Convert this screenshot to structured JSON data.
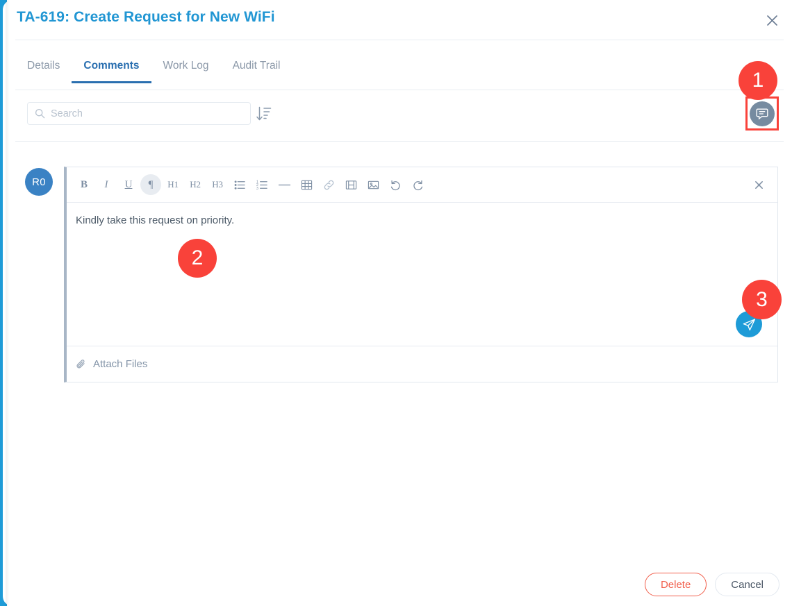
{
  "modal": {
    "title": "TA-619: Create Request for New WiFi",
    "close_icon": "close-icon"
  },
  "tabs": [
    {
      "label": "Details",
      "active": false
    },
    {
      "label": "Comments",
      "active": true
    },
    {
      "label": "Work Log",
      "active": false
    },
    {
      "label": "Audit Trail",
      "active": false
    }
  ],
  "search": {
    "placeholder": "Search",
    "value": "",
    "icon": "search-icon",
    "sort_icon": "sort-descending-icon"
  },
  "comment_toggle": {
    "icon": "comment-bubble-icon"
  },
  "editor": {
    "avatar_initials": "R0",
    "close_icon": "close-icon",
    "text": "Kindly take this request on priority.",
    "send_icon": "send-paper-plane-icon",
    "attach_label": "Attach Files",
    "attach_icon": "paperclip-icon",
    "toolbar": [
      {
        "name": "bold-button",
        "label": "B",
        "kind": "bold",
        "active": false
      },
      {
        "name": "italic-button",
        "label": "I",
        "kind": "italic",
        "active": false
      },
      {
        "name": "underline-button",
        "label": "U",
        "kind": "under",
        "active": false
      },
      {
        "name": "paragraph-button",
        "label": "¶",
        "kind": "para",
        "active": true
      },
      {
        "name": "heading-1-button",
        "label": "H1",
        "kind": "heading",
        "active": false
      },
      {
        "name": "heading-2-button",
        "label": "H2",
        "kind": "heading",
        "active": false
      },
      {
        "name": "heading-3-button",
        "label": "H3",
        "kind": "heading",
        "active": false
      },
      {
        "name": "bullet-list-button",
        "label": "",
        "kind": "svg-bullet",
        "active": false
      },
      {
        "name": "numbered-list-button",
        "label": "",
        "kind": "svg-number",
        "active": false
      },
      {
        "name": "horizontal-rule-button",
        "label": "",
        "kind": "svg-hr",
        "active": false
      },
      {
        "name": "table-button",
        "label": "",
        "kind": "svg-table",
        "active": false
      },
      {
        "name": "link-button",
        "label": "",
        "kind": "svg-link",
        "active": false
      },
      {
        "name": "video-button",
        "label": "",
        "kind": "svg-video",
        "active": false
      },
      {
        "name": "image-button",
        "label": "",
        "kind": "svg-image",
        "active": false
      },
      {
        "name": "undo-button",
        "label": "",
        "kind": "svg-undo",
        "active": false
      },
      {
        "name": "redo-button",
        "label": "",
        "kind": "svg-redo",
        "active": false
      }
    ]
  },
  "footer": {
    "delete_label": "Delete",
    "cancel_label": "Cancel"
  },
  "annotations": [
    {
      "number": "1",
      "target": "comment-toggle"
    },
    {
      "number": "2",
      "target": "editor-body"
    },
    {
      "number": "3",
      "target": "send-button"
    }
  ],
  "colors": {
    "accent_blue": "#1e9bd7",
    "title_blue": "#2196d3",
    "tab_active": "#2a6fb0",
    "marker_red": "#f9423a",
    "delete_red": "#f15f4c",
    "avatar_blue": "#3a82c4",
    "comment_icon_grey": "#768ba0"
  }
}
